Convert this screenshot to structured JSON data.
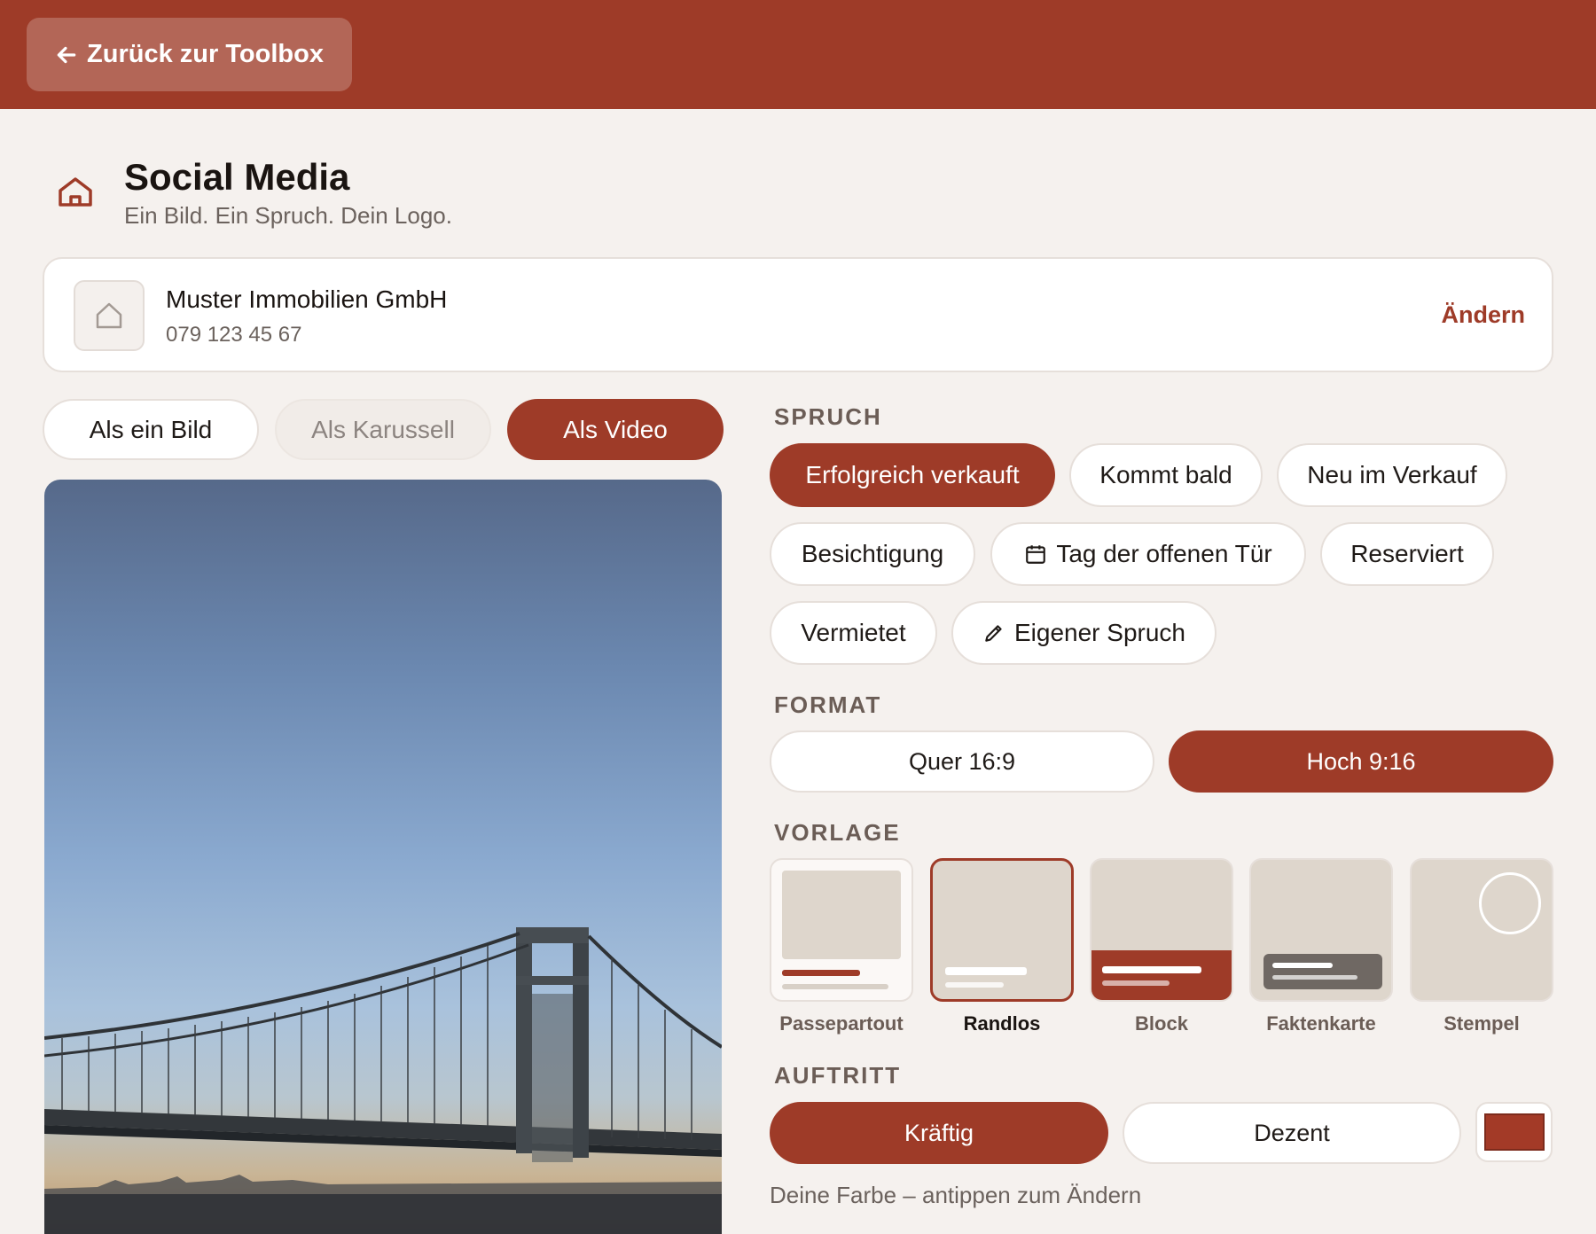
{
  "header": {
    "back_label": "Zurück zur Toolbox"
  },
  "page": {
    "title": "Social Media",
    "subtitle": "Ein Bild. Ein Spruch. Dein Logo."
  },
  "company": {
    "name": "Muster Immobilien GmbH",
    "phone": "079 123 45 67",
    "change_label": "Ändern"
  },
  "output_modes": [
    {
      "label": "Als ein Bild",
      "state": "default"
    },
    {
      "label": "Als Karussell",
      "state": "disabled"
    },
    {
      "label": "Als Video",
      "state": "selected"
    }
  ],
  "sections": {
    "spruch": "SPRUCH",
    "format": "FORMAT",
    "vorlage": "VORLAGE",
    "auftritt": "AUFTRITT"
  },
  "sprueche": [
    {
      "label": "Erfolgreich verkauft",
      "selected": true
    },
    {
      "label": "Kommt bald"
    },
    {
      "label": "Neu im Verkauf"
    },
    {
      "label": "Besichtigung"
    },
    {
      "label": "Tag der offenen Tür",
      "icon": "calendar-icon"
    },
    {
      "label": "Reserviert"
    },
    {
      "label": "Vermietet"
    },
    {
      "label": "Eigener Spruch",
      "icon": "pencil-icon"
    }
  ],
  "formats": [
    {
      "label": "Quer 16:9"
    },
    {
      "label": "Hoch 9:16",
      "selected": true
    }
  ],
  "templates": [
    {
      "label": "Passepartout"
    },
    {
      "label": "Randlos",
      "selected": true
    },
    {
      "label": "Block"
    },
    {
      "label": "Faktenkarte"
    },
    {
      "label": "Stempel"
    }
  ],
  "auftritt": [
    {
      "label": "Kräftig",
      "selected": true
    },
    {
      "label": "Dezent"
    }
  ],
  "brand_color": "#a33a27",
  "color_hint": "Deine Farbe – antippen zum Ändern"
}
